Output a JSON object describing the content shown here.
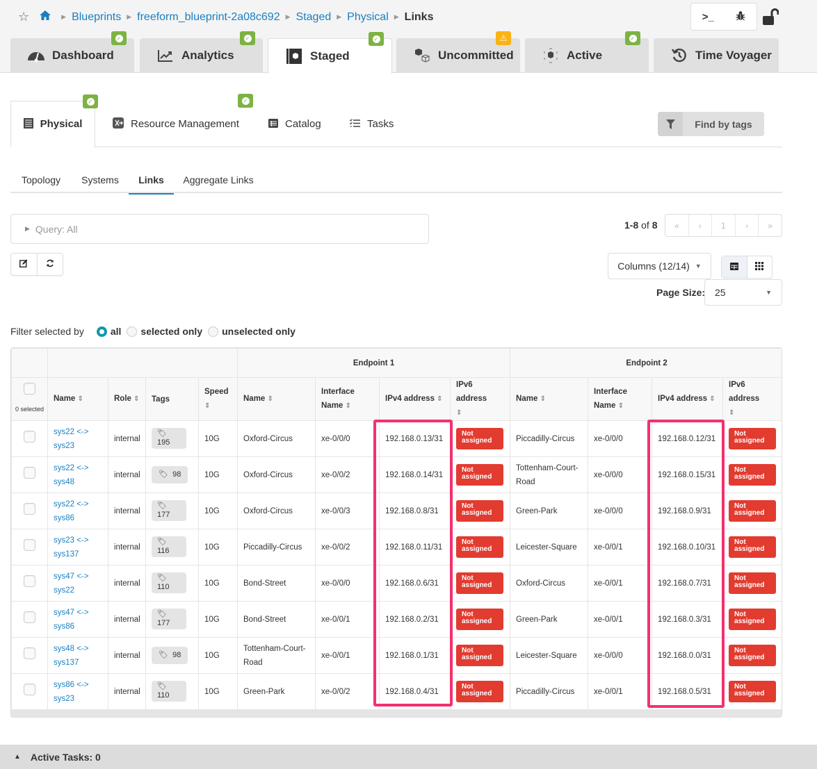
{
  "breadcrumb": {
    "items": [
      "Blueprints",
      "freeform_blueprint-2a08c692",
      "Staged",
      "Physical"
    ],
    "current": "Links"
  },
  "toolbar": {
    "cli_icon": ">_",
    "debug_icon": "bug"
  },
  "main_tabs": [
    {
      "label": "Dashboard",
      "icon": "dashboard-gauge-icon",
      "badge": "ok"
    },
    {
      "label": "Analytics",
      "icon": "chart-line-icon",
      "badge": "ok"
    },
    {
      "label": "Staged",
      "icon": "staged-box-icon",
      "badge": "ok",
      "active": true
    },
    {
      "label": "Uncommitted",
      "icon": "uncommitted-cubes-icon",
      "badge": "warning"
    },
    {
      "label": "Active",
      "icon": "active-cube-icon",
      "badge": "ok"
    },
    {
      "label": "Time Voyager",
      "icon": "history-icon",
      "badge": null
    }
  ],
  "sub_tabs": [
    {
      "label": "Physical",
      "icon": "server-rack-icon",
      "badge": "ok",
      "active": true
    },
    {
      "label": "Resource Management",
      "icon": "resource-icon",
      "badge": "ok"
    },
    {
      "label": "Catalog",
      "icon": "list-icon",
      "badge": null
    },
    {
      "label": "Tasks",
      "icon": "tasks-icon",
      "badge": null
    }
  ],
  "find_by_tags": "Find by tags",
  "view_tabs": [
    {
      "label": "Topology"
    },
    {
      "label": "Systems"
    },
    {
      "label": "Links",
      "active": true
    },
    {
      "label": "Aggregate Links"
    }
  ],
  "query": "Query: All",
  "pagination": {
    "range": "1-8",
    "of_label": "of",
    "total": "8",
    "buttons": [
      "«",
      "‹",
      "1",
      "›",
      "»"
    ]
  },
  "columns_button": "Columns (12/14)",
  "page_size": {
    "label": "Page Size:",
    "value": "25"
  },
  "filter": {
    "label": "Filter selected by",
    "options": [
      "all",
      "selected only",
      "unselected only"
    ],
    "selected": "all"
  },
  "table": {
    "group_headers": {
      "endpoint1": "Endpoint 1",
      "endpoint2": "Endpoint 2"
    },
    "selected_count": "0 selected",
    "columns": {
      "name": "Name",
      "role": "Role",
      "tags": "Tags",
      "speed": "Speed",
      "ep_name": "Name",
      "ep_iface_1": "Interface",
      "ep_iface_2": "Name",
      "ep_ipv4": "IPv4 address",
      "ep_ipv6": "IPv6 address"
    },
    "not_assigned_1": "Not",
    "not_assigned_2": "assigned",
    "rows": [
      {
        "name1": "sys22 <->",
        "name2": "sys23",
        "role": "internal",
        "tags": "195",
        "tag_inline": false,
        "speed": "10G",
        "ep1_name": "Oxford-Circus",
        "ep1_iface": "xe-0/0/0",
        "ep1_ipv4": "192.168.0.13/31",
        "ep2_name": "Piccadilly-Circus",
        "ep2_iface": "xe-0/0/0",
        "ep2_ipv4": "192.168.0.12/31"
      },
      {
        "name1": "sys22 <->",
        "name2": "sys48",
        "role": "internal",
        "tags": "98",
        "tag_inline": true,
        "speed": "10G",
        "ep1_name": "Oxford-Circus",
        "ep1_iface": "xe-0/0/2",
        "ep1_ipv4": "192.168.0.14/31",
        "ep2_name": "Tottenham-Court-Road",
        "ep2_iface": "xe-0/0/0",
        "ep2_ipv4": "192.168.0.15/31"
      },
      {
        "name1": "sys22 <->",
        "name2": "sys86",
        "role": "internal",
        "tags": "177",
        "tag_inline": false,
        "speed": "10G",
        "ep1_name": "Oxford-Circus",
        "ep1_iface": "xe-0/0/3",
        "ep1_ipv4": "192.168.0.8/31",
        "ep2_name": "Green-Park",
        "ep2_iface": "xe-0/0/0",
        "ep2_ipv4": "192.168.0.9/31"
      },
      {
        "name1": "sys23 <->",
        "name2": "sys137",
        "role": "internal",
        "tags": "116",
        "tag_inline": false,
        "speed": "10G",
        "ep1_name": "Piccadilly-Circus",
        "ep1_iface": "xe-0/0/2",
        "ep1_ipv4": "192.168.0.11/31",
        "ep2_name": "Leicester-Square",
        "ep2_iface": "xe-0/0/1",
        "ep2_ipv4": "192.168.0.10/31"
      },
      {
        "name1": "sys47 <->",
        "name2": "sys22",
        "role": "internal",
        "tags": "110",
        "tag_inline": false,
        "speed": "10G",
        "ep1_name": "Bond-Street",
        "ep1_iface": "xe-0/0/0",
        "ep1_ipv4": "192.168.0.6/31",
        "ep2_name": "Oxford-Circus",
        "ep2_iface": "xe-0/0/1",
        "ep2_ipv4": "192.168.0.7/31"
      },
      {
        "name1": "sys47 <->",
        "name2": "sys86",
        "role": "internal",
        "tags": "177",
        "tag_inline": false,
        "speed": "10G",
        "ep1_name": "Bond-Street",
        "ep1_iface": "xe-0/0/1",
        "ep1_ipv4": "192.168.0.2/31",
        "ep2_name": "Green-Park",
        "ep2_iface": "xe-0/0/1",
        "ep2_ipv4": "192.168.0.3/31"
      },
      {
        "name1": "sys48 <->",
        "name2": "sys137",
        "role": "internal",
        "tags": "98",
        "tag_inline": true,
        "speed": "10G",
        "ep1_name": "Tottenham-Court-Road",
        "ep1_iface": "xe-0/0/1",
        "ep1_ipv4": "192.168.0.1/31",
        "ep2_name": "Leicester-Square",
        "ep2_iface": "xe-0/0/0",
        "ep2_ipv4": "192.168.0.0/31"
      },
      {
        "name1": "sys86 <->",
        "name2": "sys23",
        "role": "internal",
        "tags": "110",
        "tag_inline": false,
        "speed": "10G",
        "ep1_name": "Green-Park",
        "ep1_iface": "xe-0/0/2",
        "ep1_ipv4": "192.168.0.4/31",
        "ep2_name": "Piccadilly-Circus",
        "ep2_iface": "xe-0/0/1",
        "ep2_ipv4": "192.168.0.5/31"
      }
    ]
  },
  "colors": {
    "link": "#1a7fc1",
    "ok_badge": "#7cb342",
    "warn_badge": "#f9b315",
    "not_assigned": "#e23b30",
    "highlight": "#f4306d",
    "radio_checked": "#1098a8"
  },
  "footer": {
    "active_tasks": "Active Tasks: 0"
  }
}
